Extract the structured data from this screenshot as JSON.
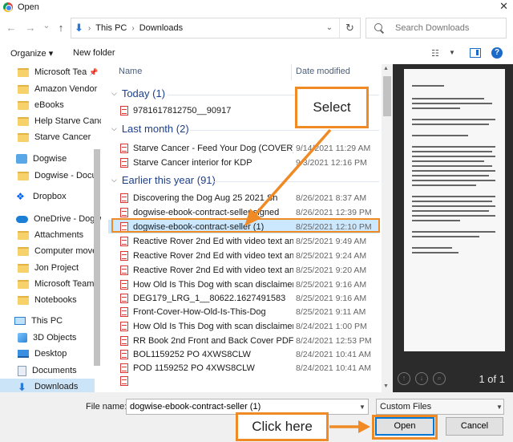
{
  "window": {
    "title": "Open"
  },
  "nav": {
    "back": "←",
    "forward": "→",
    "recent": "⌄",
    "up": "↑",
    "breadcrumbs": [
      "This PC",
      "Downloads"
    ],
    "search_placeholder": "Search Downloads"
  },
  "toolbar": {
    "organize": "Organize ▾",
    "new_folder": "New folder"
  },
  "sidebar": {
    "items": [
      {
        "label": "Microsoft Tea",
        "icon": "folder-icon",
        "pinned": true
      },
      {
        "label": "Amazon Vendor",
        "icon": "folder-icon"
      },
      {
        "label": "eBooks",
        "icon": "folder-icon"
      },
      {
        "label": "Help Starve Canc",
        "icon": "folder-icon"
      },
      {
        "label": "Starve Cancer",
        "icon": "folder-icon"
      },
      {
        "label": "Dogwise",
        "icon": "dogwise-icon"
      },
      {
        "label": "Dogwise - Docu",
        "icon": "folder-icon"
      },
      {
        "label": "Dropbox",
        "icon": "dropbox-icon"
      },
      {
        "label": "OneDrive - Dogwi",
        "icon": "cloud-icon"
      },
      {
        "label": "Attachments",
        "icon": "folder-icon"
      },
      {
        "label": "Computer move",
        "icon": "folder-icon"
      },
      {
        "label": "Jon Project",
        "icon": "folder-icon"
      },
      {
        "label": "Microsoft Teams",
        "icon": "folder-icon"
      },
      {
        "label": "Notebooks",
        "icon": "folder-icon"
      },
      {
        "label": "This PC",
        "icon": "pc-icon"
      },
      {
        "label": "3D Objects",
        "icon": "3d-objects-icon"
      },
      {
        "label": "Desktop",
        "icon": "desktop-icon"
      },
      {
        "label": "Documents",
        "icon": "documents-icon"
      },
      {
        "label": "Downloads",
        "icon": "downloads-icon",
        "selected": true
      }
    ]
  },
  "list": {
    "columns": {
      "name": "Name",
      "date": "Date modified"
    },
    "groups": [
      {
        "label": "Today (1)",
        "files": [
          {
            "name": "9781617812750__90917",
            "date": ""
          }
        ]
      },
      {
        "label": "Last month (2)",
        "files": [
          {
            "name": "Starve Cancer - Feed Your Dog (COVER) ...",
            "date": "9/14/2021 11:29 AM"
          },
          {
            "name": "Starve Cancer interior for KDP",
            "date": "9/3/2021 12:16 PM"
          }
        ]
      },
      {
        "label": "Earlier this year (91)",
        "files": [
          {
            "name": "Discovering the Dog Aug 25 2021 Sh",
            "date": "8/26/2021 8:37 AM"
          },
          {
            "name": "dogwise-ebook-contract-seller signed",
            "date": "8/26/2021 12:39 PM"
          },
          {
            "name": "dogwise-ebook-contract-seller (1)",
            "date": "8/25/2021 12:10 PM",
            "highlighted": true
          },
          {
            "name": "Reactive Rover 2nd Ed with video text an...",
            "date": "8/25/2021 9:49 AM"
          },
          {
            "name": "Reactive Rover 2nd Ed with video text an...",
            "date": "8/25/2021 9:24 AM"
          },
          {
            "name": "Reactive Rover 2nd Ed with video text an...",
            "date": "8/25/2021 9:20 AM"
          },
          {
            "name": "How Old Is This Dog with scan disclaimer...",
            "date": "8/25/2021 9:16 AM"
          },
          {
            "name": "DEG179_LRG_1__80622.1627491583",
            "date": "8/25/2021 9:16 AM"
          },
          {
            "name": "Front-Cover-How-Old-Is-This-Dog",
            "date": "8/25/2021 9:11 AM"
          },
          {
            "name": "How Old Is This Dog with scan disclaimer",
            "date": "8/24/2021 1:00 PM"
          },
          {
            "name": "RR Book 2nd Front and Back Cover PDF",
            "date": "8/24/2021 12:53 PM"
          },
          {
            "name": "BOL1159252 PO 4XWS8CLW",
            "date": "8/24/2021 10:41 AM"
          },
          {
            "name": "POD 1159252 PO 4XWS8CLW",
            "date": "8/24/2021 10:41 AM"
          }
        ]
      }
    ]
  },
  "preview": {
    "page_indicator": "1 of 1"
  },
  "footer": {
    "file_name_label": "File name:",
    "file_name_value": "dogwise-ebook-contract-seller (1)",
    "file_type": "Custom Files",
    "open_label": "Open",
    "cancel_label": "Cancel"
  },
  "annotations": {
    "select_label": "Select",
    "click_label": "Click here",
    "accent_color": "#f08a24"
  }
}
